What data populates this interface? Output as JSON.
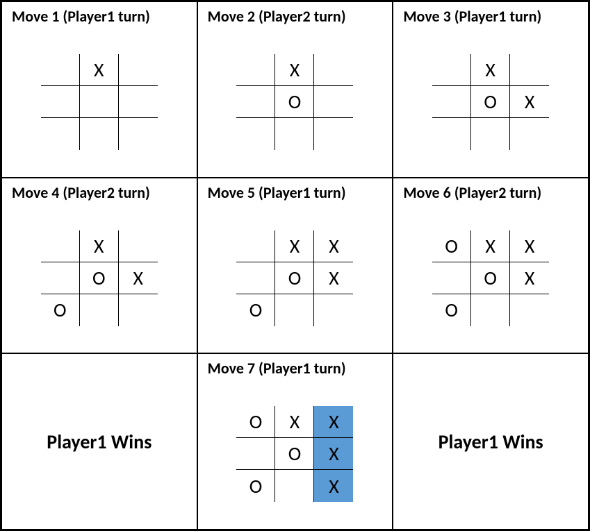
{
  "moves": [
    {
      "title": "Move 1 (Player1 turn)",
      "cells": [
        "",
        "X",
        "",
        "",
        "",
        "",
        "",
        "",
        ""
      ],
      "highlight": []
    },
    {
      "title": "Move 2 (Player2 turn)",
      "cells": [
        "",
        "X",
        "",
        "",
        "O",
        "",
        "",
        "",
        ""
      ],
      "highlight": []
    },
    {
      "title": "Move 3 (Player1 turn)",
      "cells": [
        "",
        "X",
        "",
        "",
        "O",
        "X",
        "",
        "",
        ""
      ],
      "highlight": []
    },
    {
      "title": "Move 4 (Player2 turn)",
      "cells": [
        "",
        "X",
        "",
        "",
        "O",
        "X",
        "O",
        "",
        ""
      ],
      "highlight": []
    },
    {
      "title": "Move 5 (Player1 turn)",
      "cells": [
        "",
        "X",
        "X",
        "",
        "O",
        "X",
        "O",
        "",
        ""
      ],
      "highlight": []
    },
    {
      "title": "Move 6 (Player2 turn)",
      "cells": [
        "O",
        "X",
        "X",
        "",
        "O",
        "X",
        "O",
        "",
        ""
      ],
      "highlight": []
    },
    {
      "title": "Move 7 (Player1 turn)",
      "cells": [
        "O",
        "X",
        "X",
        "",
        "O",
        "X",
        "O",
        "",
        "X"
      ],
      "highlight": [
        2,
        5,
        8
      ]
    }
  ],
  "result_left": "Player1 Wins",
  "result_right": "Player1 Wins"
}
